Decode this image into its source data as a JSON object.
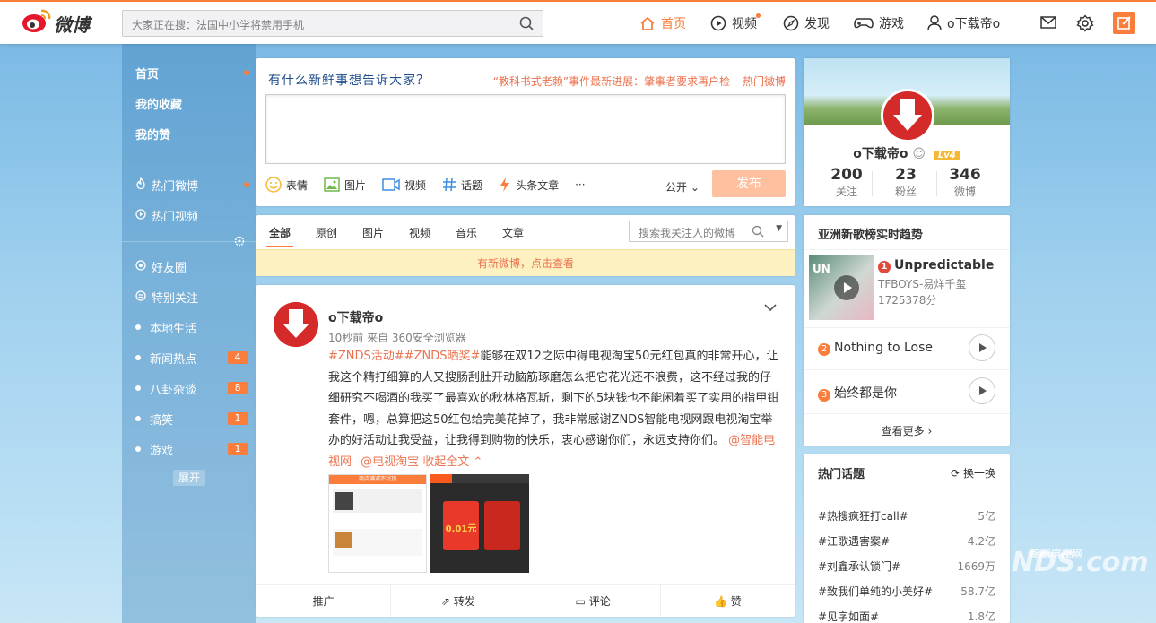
{
  "topbar": {
    "logo_text": "微博",
    "search_placeholder": "大家正在搜：法国中小学将禁用手机",
    "nav_home": "首页",
    "nav_video": "视频",
    "nav_discover": "发现",
    "nav_game": "游戏",
    "nav_user": "o下载帝o"
  },
  "sidebar": {
    "items": [
      {
        "label": "首页"
      },
      {
        "label": "我的收藏"
      },
      {
        "label": "我的赞"
      },
      {
        "label": "热门微博"
      },
      {
        "label": "热门视频"
      },
      {
        "label": "好友圈"
      },
      {
        "label": "特别关注"
      },
      {
        "label": "本地生活"
      },
      {
        "label": "新闻热点",
        "badge": "4"
      },
      {
        "label": "八卦杂谈",
        "badge": "8"
      },
      {
        "label": "搞笑",
        "badge": "1"
      },
      {
        "label": "游戏",
        "badge": "1"
      }
    ],
    "expand_label": "展开"
  },
  "publish": {
    "prompt": "有什么新鲜事想告诉大家？",
    "hot_news": "“教科书式老赖”事件最新进展：肇事者要求再户检",
    "hot_link": "热门微博",
    "tools": [
      "表情",
      "图片",
      "视频",
      "话题",
      "头条文章"
    ],
    "more": "···",
    "visibility": "公开",
    "submit": "发布"
  },
  "feed_tabs": {
    "tabs": [
      "全部",
      "原创",
      "图片",
      "视频",
      "音乐",
      "文章"
    ],
    "search_placeholder": "搜索我关注人的微博",
    "new_notice": "有新微博，点击查看"
  },
  "post": {
    "author": "o下载帝o",
    "meta": "10秒前 来自 360安全浏览器",
    "tags": "#ZNDS活动##ZNDS晒奖#",
    "text": "能够在双12之际中得电视淘宝50元红包真的非常开心，让我这个精打细算的人又搜肠刮肚开动脑筋琢磨怎么把它花光还不浪费，这不经过我的仔细研究不喝酒的我买了最喜欢的秋林格瓦斯，剩下的5块钱也不能闲着买了实用的指甲钳套件，嗯，总算把这50红包给完美花掉了，我非常感谢ZNDS智能电视网跟电视淘宝举办的好活动让我受益，让我得到购物的快乐，衷心感谢你们，永远支持你们。",
    "mention1": "@智能电视网",
    "mention2": "@电视淘宝",
    "collapse": "收起全文",
    "img1_banner": "商店满减不封顶",
    "img2_amount": "0.01元",
    "actions": [
      "推广",
      "转发",
      "评论",
      "赞"
    ]
  },
  "profile": {
    "name": "o下载帝o",
    "level": "Lv4",
    "stats": [
      {
        "num": "200",
        "label": "关注"
      },
      {
        "num": "23",
        "label": "粉丝"
      },
      {
        "num": "346",
        "label": "微博"
      }
    ]
  },
  "music": {
    "title": "亚洲新歌榜实时趋势",
    "cover_text": "UN",
    "top": {
      "rank": "1",
      "name": "Unpredictable",
      "artist": "TFBOYS-易烊千玺",
      "plays": "1725378分"
    },
    "items": [
      {
        "rank": "2",
        "name": "Nothing to Lose"
      },
      {
        "rank": "3",
        "name": "始终都是你"
      }
    ],
    "more": "查看更多"
  },
  "topics": {
    "title": "热门话题",
    "refresh": "换一换",
    "items": [
      {
        "name": "#热搜疯狂打call#",
        "count": "5亿"
      },
      {
        "name": "#江歌遇害案#",
        "count": "4.2亿"
      },
      {
        "name": "#刘鑫承认锁门#",
        "count": "1669万"
      },
      {
        "name": "#致我们单纯的小美好#",
        "count": "58.7亿"
      },
      {
        "name": "#见字如面#",
        "count": "1.8亿"
      }
    ]
  },
  "watermark": {
    "main": "NDS.com",
    "small": "智能电视网"
  }
}
